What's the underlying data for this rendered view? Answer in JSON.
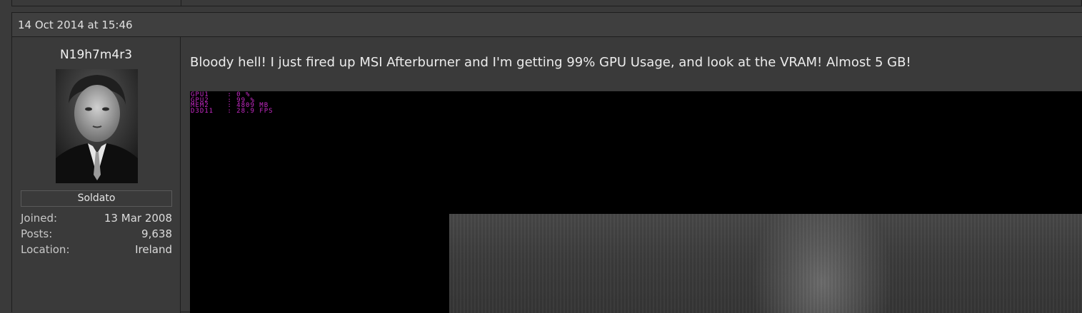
{
  "post": {
    "timestamp": "14 Oct 2014 at 15:46",
    "message": "Bloody hell! I just fired up MSI Afterburner and I'm getting 99% GPU Usage, and look at the VRAM! Almost 5 GB!"
  },
  "user": {
    "name": "N19h7m4r3",
    "rank": "Soldato",
    "stats": [
      {
        "label": "Joined:",
        "value": "13 Mar 2008"
      },
      {
        "label": "Posts:",
        "value": "9,638"
      },
      {
        "label": "Location:",
        "value": "Ireland"
      }
    ]
  },
  "screenshot": {
    "osd_lines": [
      "GPU1    : 0 %",
      "GPU2    : 99 %",
      "MEM2    : 4809 MB",
      "D3D11   : 28.9 FPS"
    ],
    "osd_color": "#c62ac6"
  },
  "colors": {
    "background": "#3a3a3a",
    "header": "#3f3f3f",
    "border": "#1e1e1e"
  }
}
